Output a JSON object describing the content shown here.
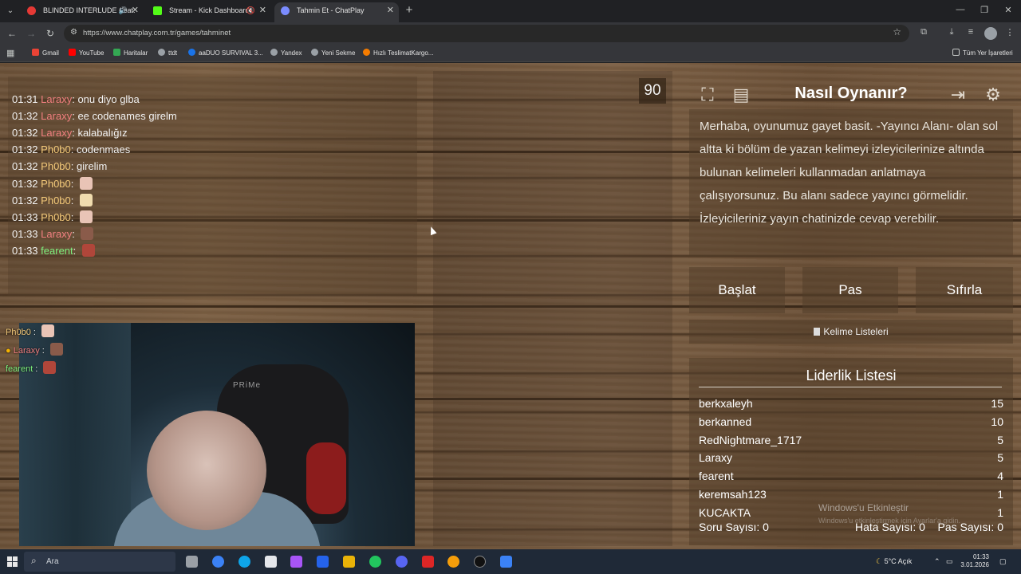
{
  "browser": {
    "tabs": [
      {
        "title": "BLINDED INTERLUDE (feat.",
        "favicon_color": "#e53935"
      },
      {
        "title": "Stream - Kick Dashboard",
        "favicon_color": "#53fc18"
      },
      {
        "title": "Tahmin Et - ChatPlay",
        "favicon_color": "#7b8cff"
      }
    ],
    "url": "https://www.chatplay.com.tr/games/tahminet",
    "bookmarks": [
      "Gmail",
      "YouTube",
      "Haritalar",
      "ttdt",
      "aaDUO SURVIVAL 3...",
      "Yandex",
      "Yeni Sekme",
      "Hızlı TeslimatKargo..."
    ],
    "all_bookmarks": "Tüm Yer İşaretleri"
  },
  "chat": {
    "messages": [
      {
        "time": "01:31",
        "user": "Laraxy",
        "color": "#f07f7f",
        "text": "onu diyo glba",
        "emote": null
      },
      {
        "time": "01:32",
        "user": "Laraxy",
        "color": "#f07f7f",
        "text": "ee codenames girelm",
        "emote": null
      },
      {
        "time": "01:32",
        "user": "Laraxy",
        "color": "#f07f7f",
        "text": "kalabalığız",
        "emote": null
      },
      {
        "time": "01:32",
        "user": "Ph0b0",
        "color": "#f3c979",
        "text": "codenmaes",
        "emote": null
      },
      {
        "time": "01:32",
        "user": "Ph0b0",
        "color": "#f3c979",
        "text": "girelim",
        "emote": null
      },
      {
        "time": "01:32",
        "user": "Ph0b0",
        "color": "#f3c979",
        "text": "",
        "emote": "#e9c4b6"
      },
      {
        "time": "01:32",
        "user": "Ph0b0",
        "color": "#f3c979",
        "text": "",
        "emote": "#f0dcae"
      },
      {
        "time": "01:33",
        "user": "Ph0b0",
        "color": "#f3c979",
        "text": "",
        "emote": "#e9c4b6"
      },
      {
        "time": "01:33",
        "user": "Laraxy",
        "color": "#f07f7f",
        "text": "",
        "emote": "#8a5b4a"
      },
      {
        "time": "01:33",
        "user": "fearent",
        "color": "#7ef07e",
        "text": "",
        "emote": "#b0463a"
      }
    ]
  },
  "cam_overlay": [
    {
      "user": "Ph0b0",
      "color": "#f3c979",
      "emote": "#e9c4b6"
    },
    {
      "user": "Laraxy",
      "color": "#f07f7f",
      "emote": "#8a5b4a"
    },
    {
      "user": "fearent",
      "color": "#7ef07e",
      "emote": "#b0463a"
    }
  ],
  "cam": {
    "chair_brand": "PRiMe"
  },
  "timer": "90",
  "how_to": {
    "title": "Nasıl Oynanır?",
    "text": "Merhaba, oyunumuz gayet basit. -Yayıncı Alanı- olan sol altta ki bölüm de yazan kelimeyi izleyicilerinize altında bulunan kelimeleri kullanmadan anlatmaya çalışıyorsunuz. Bu alanı sadece yayıncı görmelidir. İzleyicileriniz yayın chatinizde cevap verebilir."
  },
  "actions": {
    "start": "Başlat",
    "pass": "Pas",
    "reset": "Sıfırla"
  },
  "word_lists_label": "Kelime Listeleri",
  "leaderboard": {
    "title": "Liderlik Listesi",
    "rows": [
      {
        "name": "berkxaleyh",
        "score": "15"
      },
      {
        "name": "berkanned",
        "score": "10"
      },
      {
        "name": "RedNightmare_1717",
        "score": "5"
      },
      {
        "name": "Laraxy",
        "score": "5"
      },
      {
        "name": "fearent",
        "score": "4"
      },
      {
        "name": "keremsah123",
        "score": "1"
      },
      {
        "name": "KUCAKTA",
        "score": "1"
      }
    ],
    "question_count": "Soru Sayısı: 0",
    "error_count": "Hata Sayısı: 0",
    "pass_count": "Pas Sayısı: 0"
  },
  "watermark": {
    "title": "Windows'u Etkinleştir",
    "subtitle": "Windows'u etkinleştirmek için Ayarlar'a gidin."
  },
  "taskbar": {
    "search_placeholder": "Ara",
    "weather": "5°C  Açık",
    "time": "01:33",
    "date": "3.01.2026"
  }
}
